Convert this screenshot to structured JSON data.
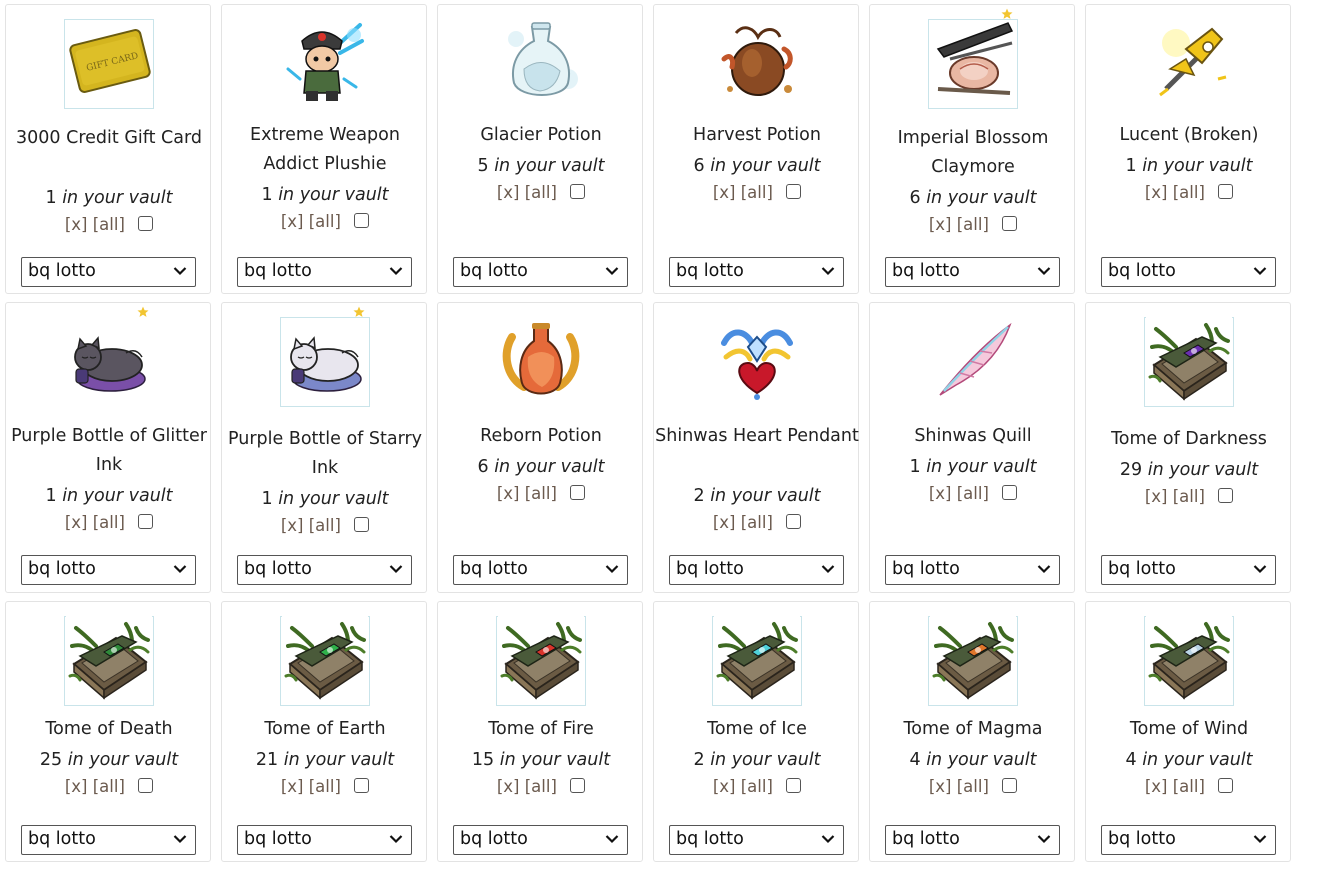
{
  "items": [
    {
      "name": "3000 Credit Gift Card",
      "count": "1",
      "icon": "gift-card-icon",
      "framed": true,
      "star": false
    },
    {
      "name": "Extreme Weapon Addict Plushie",
      "count": "1",
      "icon": "plushie-icon",
      "framed": false,
      "star": false
    },
    {
      "name": "Glacier Potion",
      "count": "5",
      "icon": "glacier-potion-icon",
      "framed": false,
      "star": false
    },
    {
      "name": "Harvest Potion",
      "count": "6",
      "icon": "harvest-potion-icon",
      "framed": false,
      "star": false
    },
    {
      "name": "Imperial Blossom Claymore",
      "count": "6",
      "icon": "claymore-icon",
      "framed": true,
      "star": true
    },
    {
      "name": "Lucent (Broken)",
      "count": "1",
      "icon": "lucent-weapon-icon",
      "framed": false,
      "star": false
    },
    {
      "name": "Purple Bottle of Glitter Ink",
      "count": "1",
      "icon": "glitter-ink-icon",
      "framed": false,
      "star": true
    },
    {
      "name": "Purple Bottle of Starry Ink",
      "count": "1",
      "icon": "starry-ink-icon",
      "framed": true,
      "star": true
    },
    {
      "name": "Reborn Potion",
      "count": "6",
      "icon": "reborn-potion-icon",
      "framed": false,
      "star": false
    },
    {
      "name": "Shinwas Heart Pendant",
      "count": "2",
      "icon": "heart-pendant-icon",
      "framed": false,
      "star": false
    },
    {
      "name": "Shinwas Quill",
      "count": "1",
      "icon": "quill-icon",
      "framed": false,
      "star": false
    },
    {
      "name": "Tome of Darkness",
      "count": "29",
      "icon": "tome-darkness-icon",
      "framed": true,
      "star": false
    },
    {
      "name": "Tome of Death",
      "count": "25",
      "icon": "tome-death-icon",
      "framed": true,
      "star": false
    },
    {
      "name": "Tome of Earth",
      "count": "21",
      "icon": "tome-earth-icon",
      "framed": true,
      "star": false
    },
    {
      "name": "Tome of Fire",
      "count": "15",
      "icon": "tome-fire-icon",
      "framed": true,
      "star": false
    },
    {
      "name": "Tome of Ice",
      "count": "2",
      "icon": "tome-ice-icon",
      "framed": true,
      "star": false
    },
    {
      "name": "Tome of Magma",
      "count": "4",
      "icon": "tome-magma-icon",
      "framed": true,
      "star": false
    },
    {
      "name": "Tome of Wind",
      "count": "4",
      "icon": "tome-wind-icon",
      "framed": true,
      "star": false
    }
  ],
  "labels": {
    "in_vault": "in your vault",
    "remove_one": "[x]",
    "remove_all": "[all]",
    "select_value": "bq lotto"
  },
  "colors": {
    "card_border": "#e3e3e3",
    "frame_border": "#c9e4ea",
    "action_text": "#6b5a4e",
    "star": "#f2c531",
    "tome_darkness": "#6a2fb0",
    "tome_death": "#2f8a3a",
    "tome_earth": "#2fb04a",
    "tome_fire": "#d9332a",
    "tome_ice": "#4fd1d9",
    "tome_magma": "#e0762a",
    "tome_wind": "#b9d4e6"
  }
}
